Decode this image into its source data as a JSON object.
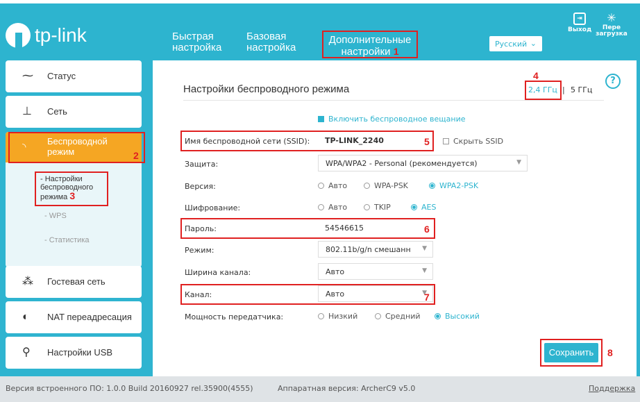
{
  "header": {
    "logo": "tp-link",
    "nav_quick": [
      "Быстрая",
      "настройка"
    ],
    "nav_basic": [
      "Базовая",
      "настройка"
    ],
    "nav_advanced": [
      "Дополнительные",
      "настройки"
    ],
    "language": "Русский",
    "logout": "Выход",
    "reboot": [
      "Пере",
      "загрузка"
    ]
  },
  "sidebar": {
    "status": "Статус",
    "network": "Сеть",
    "wireless": [
      "Беспроводной",
      "режим"
    ],
    "wireless_sub": {
      "settings": [
        "- Настройки",
        "беспроводного",
        "режима"
      ],
      "wps": "- WPS",
      "stats": "- Статистика"
    },
    "guest": "Гостевая сеть",
    "nat": "NAT переадресация",
    "usb": "Настройки USB"
  },
  "main": {
    "title": "Настройки беспроводного режима",
    "band_24": "2,4 ГГц",
    "band_sep": "|",
    "band_5": "5 ГГц",
    "help": "?",
    "enable_broadcast": "Включить беспроводное вещание",
    "ssid_label": "Имя беспроводной сети (SSID):",
    "ssid_value": "TP-LINK_2240",
    "hide_ssid": "Скрыть SSID",
    "security_label": "Защита:",
    "security_value": "WPA/WPA2 - Personal (рекомендуется)",
    "version_label": "Версия:",
    "version_opts": [
      "Авто",
      "WPA-PSK",
      "WPA2-PSK"
    ],
    "encryption_label": "Шифрование:",
    "encryption_opts": [
      "Авто",
      "TKIP",
      "AES"
    ],
    "password_label": "Пароль:",
    "password_value": "54546615",
    "mode_label": "Режим:",
    "mode_value": "802.11b/g/n смешанн",
    "width_label": "Ширина канала:",
    "width_value": "Авто",
    "channel_label": "Канал:",
    "channel_value": "Авто",
    "power_label": "Мощность передатчика:",
    "power_opts": [
      "Низкий",
      "Средний",
      "Высокий"
    ],
    "save": "Сохранить"
  },
  "annotations": [
    "1",
    "2",
    "3",
    "4",
    "5",
    "6",
    "7",
    "8"
  ],
  "footer": {
    "firmware": "Версия встроенного ПО: 1.0.0 Build 20160927 rel.35900(4555)",
    "hardware": "Аппаратная версия: ArcherC9 v5.0",
    "support": "Поддержка"
  },
  "colors": {
    "accent": "#2db4cf",
    "active": "#f5a623",
    "annotation": "#e02020"
  }
}
